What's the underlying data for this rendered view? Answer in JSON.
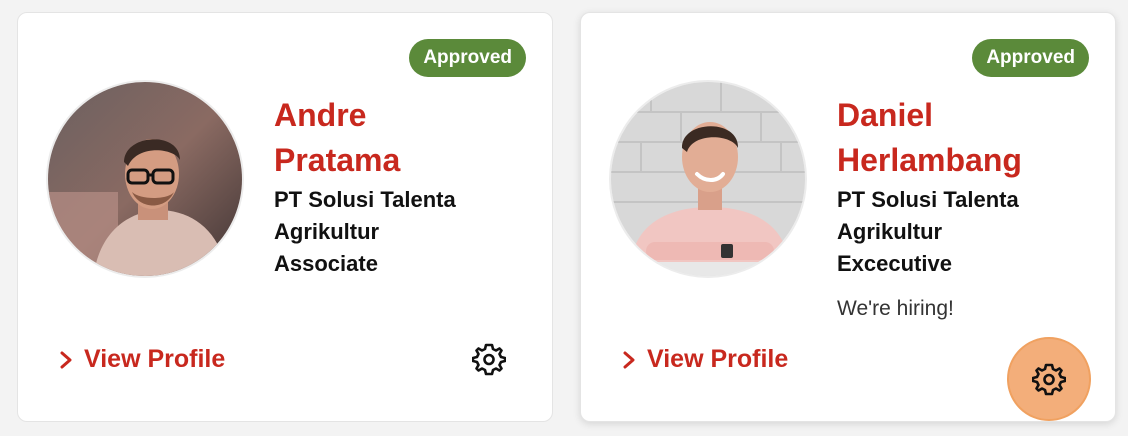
{
  "colors": {
    "accent": "#c8281e",
    "badge_bg": "#5b8a3a",
    "highlight": "#f3ae7a"
  },
  "cards": [
    {
      "status": "Approved",
      "name_line1": "Andre",
      "name_line2": "Pratama",
      "company": "PT Solusi Talenta Agrikultur",
      "role": "Associate",
      "tagline": "",
      "view_label": "View Profile",
      "avatar": "profile-photo-andre",
      "chevron_icon": "chevron-right-icon",
      "settings_icon": "gear-icon"
    },
    {
      "status": "Approved",
      "name_line1": "Daniel",
      "name_line2": "Herlambang",
      "company": "PT Solusi Talenta Agrikultur",
      "role": "Excecutive",
      "tagline": "We're hiring!",
      "view_label": "View Profile",
      "avatar": "profile-photo-daniel",
      "chevron_icon": "chevron-right-icon",
      "settings_icon": "gear-icon"
    }
  ]
}
